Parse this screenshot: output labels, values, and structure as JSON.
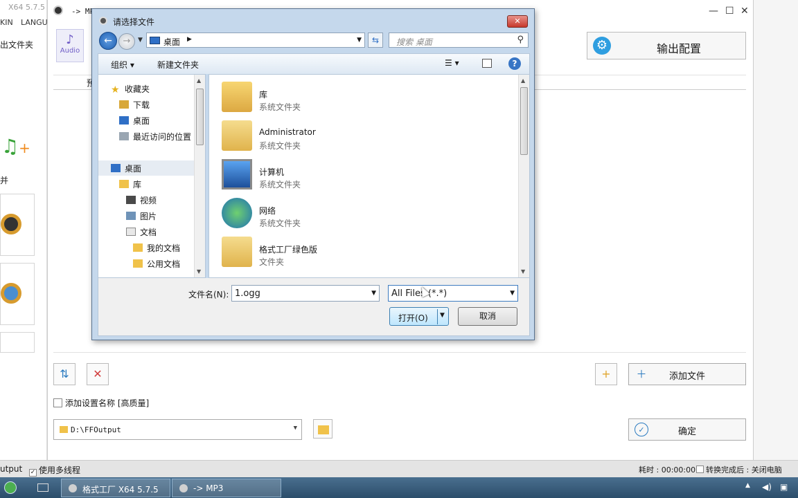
{
  "background_app": {
    "title": "X64 5.7.5",
    "menu_items": [
      "KIN",
      "LANGU"
    ],
    "output_folder_label": "出文件夹",
    "merge_label": "并"
  },
  "sub_window": {
    "title": "-> MP",
    "audio_button_label": "Audio",
    "output_config_label": "输出配置",
    "column_header_partial": "预",
    "add_file_label": "添加文件",
    "confirm_label": "确定",
    "add_setting_name_label": "添加设置名称 [高质量]",
    "output_path": "D:\\FFOutput"
  },
  "status_bar": {
    "output_partial": "utput",
    "multithread_label": "使用多线程",
    "multithread_checked": "✓",
    "elapsed_label": "耗时 : 00:00:00",
    "after_convert_label": "转换完成后 : 关闭电脑"
  },
  "taskbar": {
    "items": [
      {
        "label": "格式工厂 X64 5.7.5"
      },
      {
        "label": "-> MP3"
      }
    ]
  },
  "dialog": {
    "title": "请选择文件",
    "close_glyph": "✕",
    "address": "桌面",
    "search_placeholder": "搜索 桌面",
    "organize_label": "组织 ▾",
    "new_folder_label": "新建文件夹",
    "help_glyph": "?",
    "nav_items": [
      {
        "label": "收藏夹"
      },
      {
        "label": "下载"
      },
      {
        "label": "桌面"
      },
      {
        "label": "最近访问的位置"
      },
      {
        "label": "桌面"
      },
      {
        "label": "库"
      },
      {
        "label": "视频"
      },
      {
        "label": "图片"
      },
      {
        "label": "文档"
      },
      {
        "label": "我的文档"
      },
      {
        "label": "公用文档"
      }
    ],
    "files": [
      {
        "name": "库",
        "type": "系统文件夹"
      },
      {
        "name": "Administrator",
        "type": "系统文件夹"
      },
      {
        "name": "计算机",
        "type": "系统文件夹"
      },
      {
        "name": "网络",
        "type": "系统文件夹"
      },
      {
        "name": "格式工厂绿色版",
        "type": "文件夹"
      }
    ],
    "filename_label": "文件名(N):",
    "filename_value": "1.ogg",
    "filter_value": "All Files (*.*)",
    "open_label": "打开(O)",
    "cancel_label": "取消"
  },
  "colors": {
    "dialog_frame": "#c5d8ec",
    "close_button": "#c7382b",
    "taskbar": "#2b4d6a",
    "accent_blue": "#2f6fc6"
  }
}
